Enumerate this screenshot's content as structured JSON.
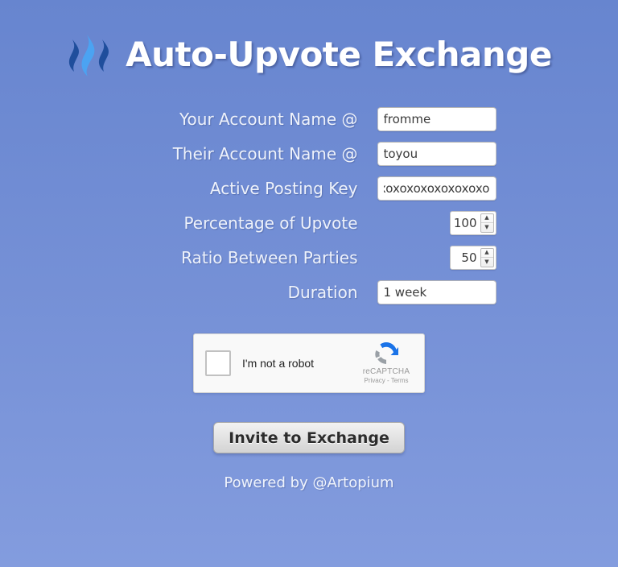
{
  "page": {
    "title": "Auto-Upvote Exchange",
    "logo_icon": "steem-waves-icon",
    "background_top_color": "#6785cf",
    "background_bottom_color": "#839cde"
  },
  "form": {
    "fields": [
      {
        "label": "Your Account Name @",
        "name": "your-account-name",
        "type": "text",
        "value": "fromme",
        "placeholder": ""
      },
      {
        "label": "Their Account Name @",
        "name": "their-account-name",
        "type": "text",
        "value": "toyou",
        "placeholder": ""
      },
      {
        "label": "Active Posting Key",
        "name": "active-posting-key",
        "type": "text",
        "value": "xoxoxoxoxoxoxoxoxoxoxo",
        "placeholder": ""
      },
      {
        "label": "Percentage of Upvote",
        "name": "percentage-of-upvote",
        "type": "number",
        "value": "100",
        "placeholder": ""
      },
      {
        "label": "Ratio Between Parties",
        "name": "ratio-between-parties",
        "type": "number",
        "value": "50",
        "placeholder": ""
      },
      {
        "label": "Duration",
        "name": "duration",
        "type": "text",
        "value": "1 week",
        "placeholder": ""
      }
    ],
    "spinner_up_glyph": "▲",
    "spinner_down_glyph": "▼"
  },
  "recaptcha": {
    "checkbox_name": "recaptcha-checkbox",
    "label": "I'm not a robot",
    "brand": "reCAPTCHA",
    "legal": "Privacy - Terms",
    "logo_icon": "recaptcha-logo-icon"
  },
  "submit": {
    "label": "Invite to Exchange"
  },
  "footer": {
    "text": "Powered by @Artopium"
  }
}
